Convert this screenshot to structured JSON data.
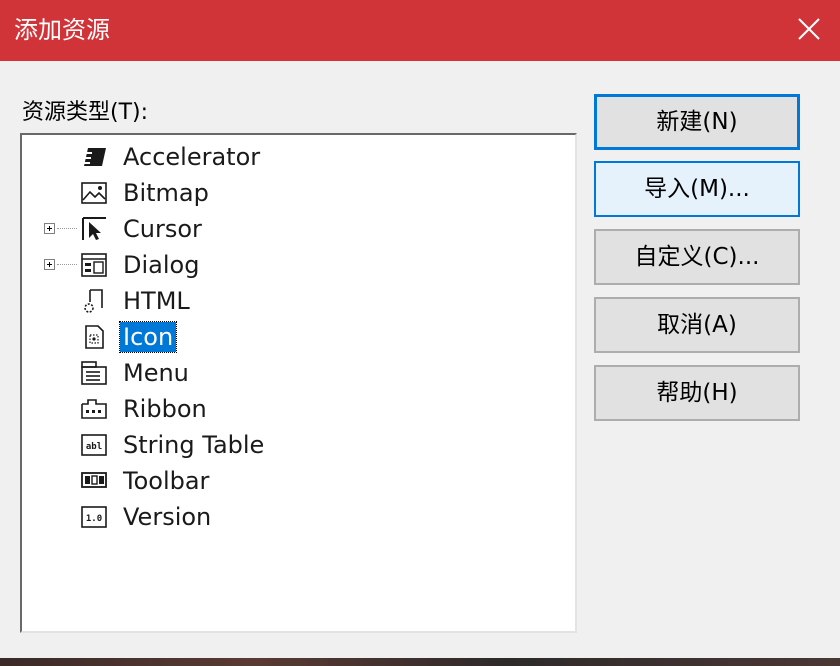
{
  "window": {
    "title": "添加资源",
    "titlebar_color": "#d13438"
  },
  "resource_types_label": "资源类型(T):",
  "tree": {
    "items": [
      {
        "label": "Accelerator",
        "icon": "accelerator-icon",
        "expandable": false,
        "selected": false
      },
      {
        "label": "Bitmap",
        "icon": "bitmap-icon",
        "expandable": false,
        "selected": false
      },
      {
        "label": "Cursor",
        "icon": "cursor-icon",
        "expandable": true,
        "selected": false
      },
      {
        "label": "Dialog",
        "icon": "dialog-icon",
        "expandable": true,
        "selected": false
      },
      {
        "label": "HTML",
        "icon": "html-icon",
        "expandable": false,
        "selected": false
      },
      {
        "label": "Icon",
        "icon": "icon-resource-icon",
        "expandable": false,
        "selected": true
      },
      {
        "label": "Menu",
        "icon": "menu-icon",
        "expandable": false,
        "selected": false
      },
      {
        "label": "Ribbon",
        "icon": "ribbon-icon",
        "expandable": false,
        "selected": false
      },
      {
        "label": "String Table",
        "icon": "string-table-icon",
        "expandable": false,
        "selected": false
      },
      {
        "label": "Toolbar",
        "icon": "toolbar-icon",
        "expandable": false,
        "selected": false
      },
      {
        "label": "Version",
        "icon": "version-icon",
        "expandable": false,
        "selected": false
      }
    ]
  },
  "buttons": {
    "new": "新建(N)",
    "import": "导入(M)...",
    "custom": "自定义(C)...",
    "cancel": "取消(A)",
    "help": "帮助(H)"
  },
  "colors": {
    "selection": "#0078d7",
    "accent": "#0078d7"
  }
}
